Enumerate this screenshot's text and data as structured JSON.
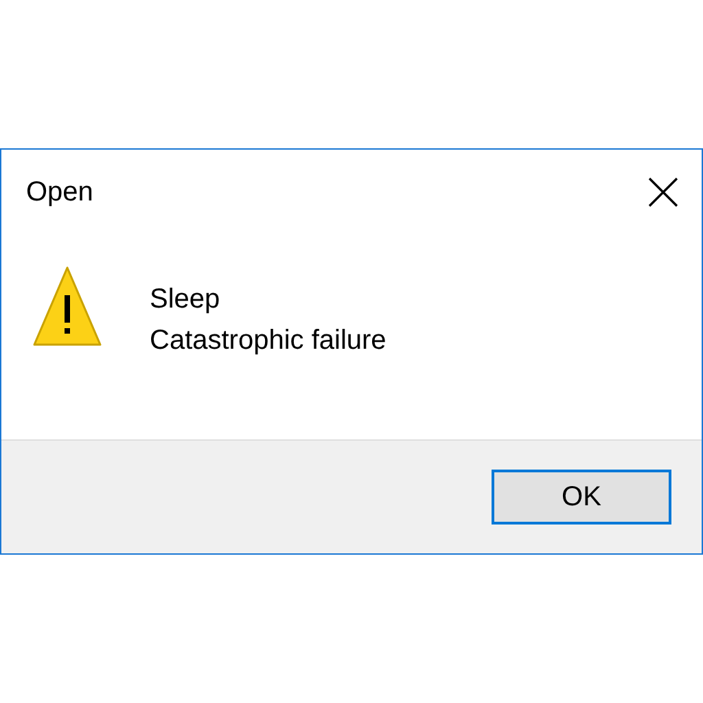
{
  "window": {
    "title": "Open"
  },
  "message": {
    "lines": [
      "Sleep",
      "Catastrophic failure"
    ]
  },
  "buttons": [
    {
      "label": "OK",
      "selected": true
    }
  ]
}
